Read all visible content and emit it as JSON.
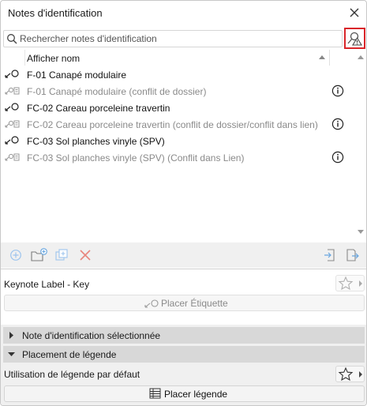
{
  "window": {
    "title": "Notes d'identification"
  },
  "search": {
    "placeholder": "Rechercher notes d'identification"
  },
  "list": {
    "column_header": "Afficher nom",
    "rows": [
      {
        "label": "F-01 Canapé modulaire",
        "state": "active",
        "info": false
      },
      {
        "label": "F-01 Canapé modulaire (conflit de dossier)",
        "state": "conflict",
        "info": true
      },
      {
        "label": "FC-02 Careau porceleine travertin",
        "state": "active",
        "info": false
      },
      {
        "label": "FC-02 Careau porceleine travertin (conflit de dossier/conflit dans lien)",
        "state": "conflict",
        "info": true
      },
      {
        "label": "FC-03 Sol planches vinyle (SPV)",
        "state": "active",
        "info": false
      },
      {
        "label": "FC-03 Sol planches vinyle (SPV) (Conflit dans Lien)",
        "state": "conflict",
        "info": true
      }
    ]
  },
  "label_section": {
    "title": "Keynote Label - Key",
    "place_button": "Placer Étiquette"
  },
  "accordions": {
    "selected": "Note d'identification sélectionnée",
    "legend": "Placement de légende"
  },
  "legend_section": {
    "default_label": "Utilisation de légende par défaut",
    "place_button": "Placer légende"
  },
  "colors": {
    "accent_icon": "#6aa7e0",
    "delete_red": "#e05a4e",
    "highlight_border": "#d9262a",
    "conflict_text": "#8a8a8a"
  }
}
